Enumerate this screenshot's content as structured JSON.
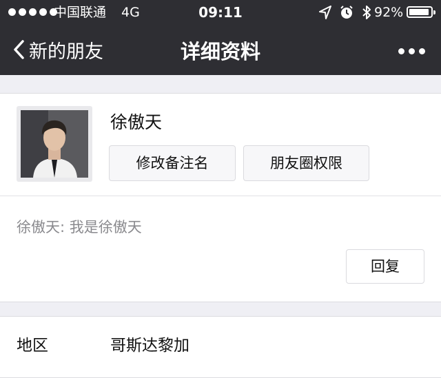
{
  "status_bar": {
    "carrier": "中国联通",
    "network": "4G",
    "time": "09:11",
    "battery_percent": "92%",
    "battery_level": 0.92,
    "icons": [
      "location-arrow-icon",
      "alarm-icon",
      "bluetooth-icon"
    ]
  },
  "nav": {
    "back_label": "新的朋友",
    "title": "详细资料",
    "more_icon": "more-dots-icon"
  },
  "profile": {
    "name": "徐傲天",
    "remark_button": "修改备注名",
    "moments_button": "朋友圈权限",
    "greeting": "徐傲天: 我是徐傲天",
    "reply_button": "回复"
  },
  "info": {
    "region_label": "地区",
    "region_value": "哥斯达黎加"
  },
  "colors": {
    "nav_background": "#2e2e33",
    "page_background": "#efeff4",
    "muted_text": "#8a8a8e"
  }
}
